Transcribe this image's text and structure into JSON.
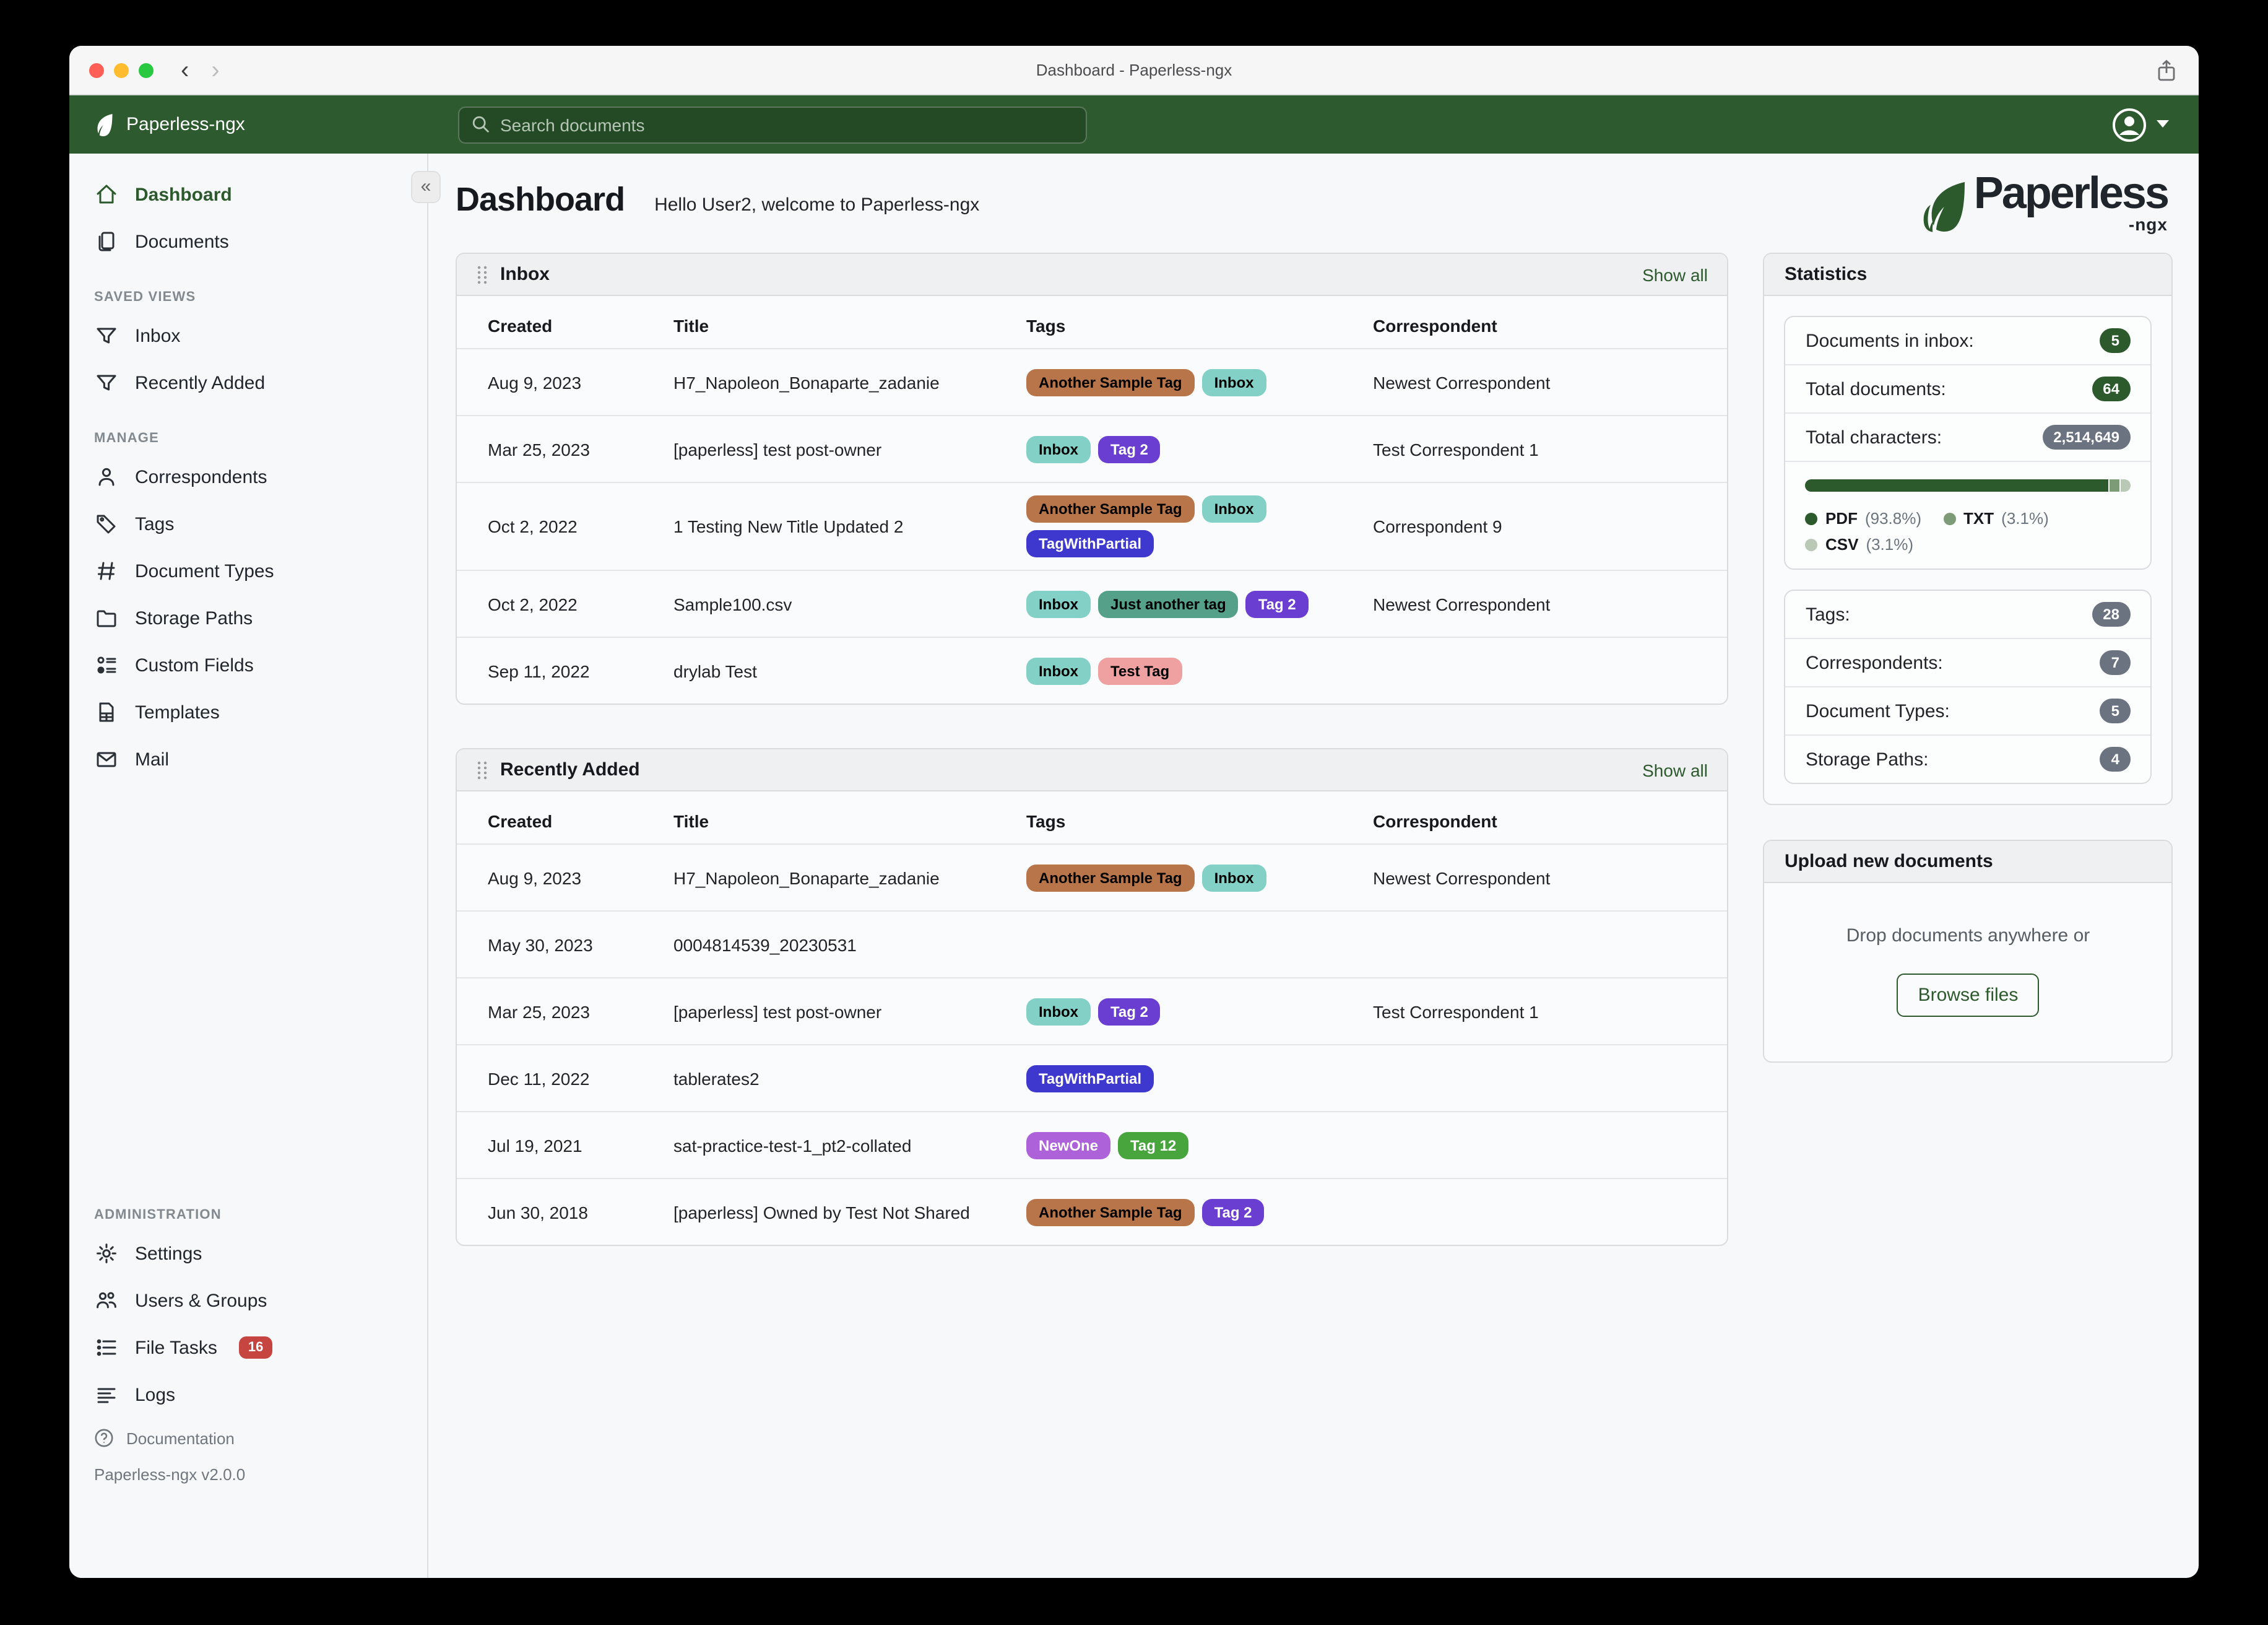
{
  "window": {
    "title": "Dashboard - Paperless-ngx",
    "traffic_lights": [
      "#ff5f57",
      "#febc2e",
      "#28c840"
    ],
    "back_glyph": "‹",
    "forward_glyph": "›"
  },
  "navbar": {
    "brand": "Paperless-ngx",
    "search_placeholder": "Search documents",
    "background": "#2d5a2e"
  },
  "sidebar": {
    "collapse_glyph": "«",
    "sections": [
      {
        "header": null,
        "items": [
          {
            "label": "Dashboard",
            "icon": "home",
            "active": true
          },
          {
            "label": "Documents",
            "icon": "documents",
            "active": false
          }
        ]
      },
      {
        "header": "SAVED VIEWS",
        "items": [
          {
            "label": "Inbox",
            "icon": "filter",
            "active": false
          },
          {
            "label": "Recently Added",
            "icon": "filter",
            "active": false
          }
        ]
      },
      {
        "header": "MANAGE",
        "items": [
          {
            "label": "Correspondents",
            "icon": "person",
            "active": false
          },
          {
            "label": "Tags",
            "icon": "tag",
            "active": false
          },
          {
            "label": "Document Types",
            "icon": "hash",
            "active": false
          },
          {
            "label": "Storage Paths",
            "icon": "folder",
            "active": false
          },
          {
            "label": "Custom Fields",
            "icon": "customfields",
            "active": false
          },
          {
            "label": "Templates",
            "icon": "template",
            "active": false
          },
          {
            "label": "Mail",
            "icon": "mail",
            "active": false
          }
        ]
      },
      {
        "header": "ADMINISTRATION",
        "items": [
          {
            "label": "Settings",
            "icon": "gear",
            "active": false
          },
          {
            "label": "Users & Groups",
            "icon": "users",
            "active": false
          },
          {
            "label": "File Tasks",
            "icon": "tasks",
            "active": false,
            "badge": "16"
          },
          {
            "label": "Logs",
            "icon": "logs",
            "active": false
          }
        ]
      }
    ],
    "documentation_label": "Documentation",
    "version": "Paperless-ngx v2.0.0"
  },
  "page": {
    "title": "Dashboard",
    "subtitle": "Hello User2, welcome to Paperless-ngx"
  },
  "logo": {
    "word": "Paperless",
    "suffix": "-ngx",
    "leaf_color": "#2d5a2d"
  },
  "tag_palette": {
    "another_sample_tag": {
      "label": "Another Sample Tag",
      "bg": "#b9754a",
      "fg": "#000000"
    },
    "inbox": {
      "label": "Inbox",
      "bg": "#83d1c6",
      "fg": "#000000"
    },
    "tag2": {
      "label": "Tag 2",
      "bg": "#6b3ed2",
      "fg": "#ffffff"
    },
    "tagwithpartial": {
      "label": "TagWithPartial",
      "bg": "#3f38cf",
      "fg": "#ffffff"
    },
    "just_another_tag": {
      "label": "Just another tag",
      "bg": "#55a089",
      "fg": "#000000"
    },
    "test_tag": {
      "label": "Test Tag",
      "bg": "#efa0a0",
      "fg": "#000000"
    },
    "newone": {
      "label": "NewOne",
      "bg": "#ad62da",
      "fg": "#ffffff"
    },
    "tag12": {
      "label": "Tag 12",
      "bg": "#48a53e",
      "fg": "#ffffff"
    }
  },
  "widgets": [
    {
      "title": "Inbox",
      "show_all": "Show all",
      "columns": [
        "Created",
        "Title",
        "Tags",
        "Correspondent"
      ],
      "rows": [
        {
          "created": "Aug 9, 2023",
          "title": "H7_Napoleon_Bonaparte_zadanie",
          "tags": [
            "another_sample_tag",
            "inbox"
          ],
          "correspondent": "Newest Correspondent"
        },
        {
          "created": "Mar 25, 2023",
          "title": "[paperless] test post-owner",
          "tags": [
            "inbox",
            "tag2"
          ],
          "correspondent": "Test Correspondent 1"
        },
        {
          "created": "Oct 2, 2022",
          "title": "1 Testing New Title Updated 2",
          "tags": [
            "another_sample_tag",
            "inbox",
            "tagwithpartial"
          ],
          "correspondent": "Correspondent 9"
        },
        {
          "created": "Oct 2, 2022",
          "title": "Sample100.csv",
          "tags": [
            "inbox",
            "just_another_tag",
            "tag2"
          ],
          "correspondent": "Newest Correspondent"
        },
        {
          "created": "Sep 11, 2022",
          "title": "drylab Test",
          "tags": [
            "inbox",
            "test_tag"
          ],
          "correspondent": ""
        }
      ]
    },
    {
      "title": "Recently Added",
      "show_all": "Show all",
      "columns": [
        "Created",
        "Title",
        "Tags",
        "Correspondent"
      ],
      "rows": [
        {
          "created": "Aug 9, 2023",
          "title": "H7_Napoleon_Bonaparte_zadanie",
          "tags": [
            "another_sample_tag",
            "inbox"
          ],
          "correspondent": "Newest Correspondent"
        },
        {
          "created": "May 30, 2023",
          "title": "0004814539_20230531",
          "tags": [],
          "correspondent": ""
        },
        {
          "created": "Mar 25, 2023",
          "title": "[paperless] test post-owner",
          "tags": [
            "inbox",
            "tag2"
          ],
          "correspondent": "Test Correspondent 1"
        },
        {
          "created": "Dec 11, 2022",
          "title": "tablerates2",
          "tags": [
            "tagwithpartial"
          ],
          "correspondent": ""
        },
        {
          "created": "Jul 19, 2021",
          "title": "sat-practice-test-1_pt2-collated",
          "tags": [
            "newone",
            "tag12"
          ],
          "correspondent": ""
        },
        {
          "created": "Jun 30, 2018",
          "title": "[paperless] Owned by Test Not Shared",
          "tags": [
            "another_sample_tag",
            "tag2"
          ],
          "correspondent": ""
        }
      ]
    }
  ],
  "statistics": {
    "title": "Statistics",
    "rows": [
      {
        "label": "Documents in inbox:",
        "value": "5",
        "badge": "green"
      },
      {
        "label": "Total documents:",
        "value": "64",
        "badge": "green"
      },
      {
        "label": "Total characters:",
        "value": "2,514,649",
        "badge": "gray"
      }
    ],
    "file_types": [
      {
        "label": "PDF",
        "pct": "93.8%",
        "value": 93.8,
        "color": "#2d5a2d"
      },
      {
        "label": "TXT",
        "pct": "3.1%",
        "value": 3.1,
        "color": "#7d9b77"
      },
      {
        "label": "CSV",
        "pct": "3.1%",
        "value": 3.1,
        "color": "#bac9b5"
      }
    ],
    "counts": [
      {
        "label": "Tags:",
        "value": "28",
        "badge": "gray"
      },
      {
        "label": "Correspondents:",
        "value": "7",
        "badge": "gray"
      },
      {
        "label": "Document Types:",
        "value": "5",
        "badge": "gray"
      },
      {
        "label": "Storage Paths:",
        "value": "4",
        "badge": "gray"
      }
    ]
  },
  "upload": {
    "title": "Upload new documents",
    "drop_text": "Drop documents anywhere or",
    "browse_label": "Browse files"
  }
}
